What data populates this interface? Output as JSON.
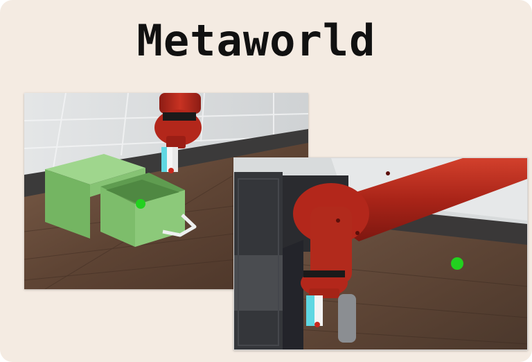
{
  "header": {
    "title": "Metaworld"
  },
  "panels": [
    {
      "scene": "drawer-task",
      "description_icon": "robot-arm-icon"
    },
    {
      "scene": "door-task",
      "description_icon": "robot-arm-icon"
    }
  ],
  "colors": {
    "background": "#f4ebe2",
    "title": "#111111",
    "table_wood": "#6b4f3e",
    "drawer_green": "#7fbf6e",
    "robot_red": "#b3271b",
    "target_green": "#22d11f",
    "door_dark": "#2e2f33"
  }
}
